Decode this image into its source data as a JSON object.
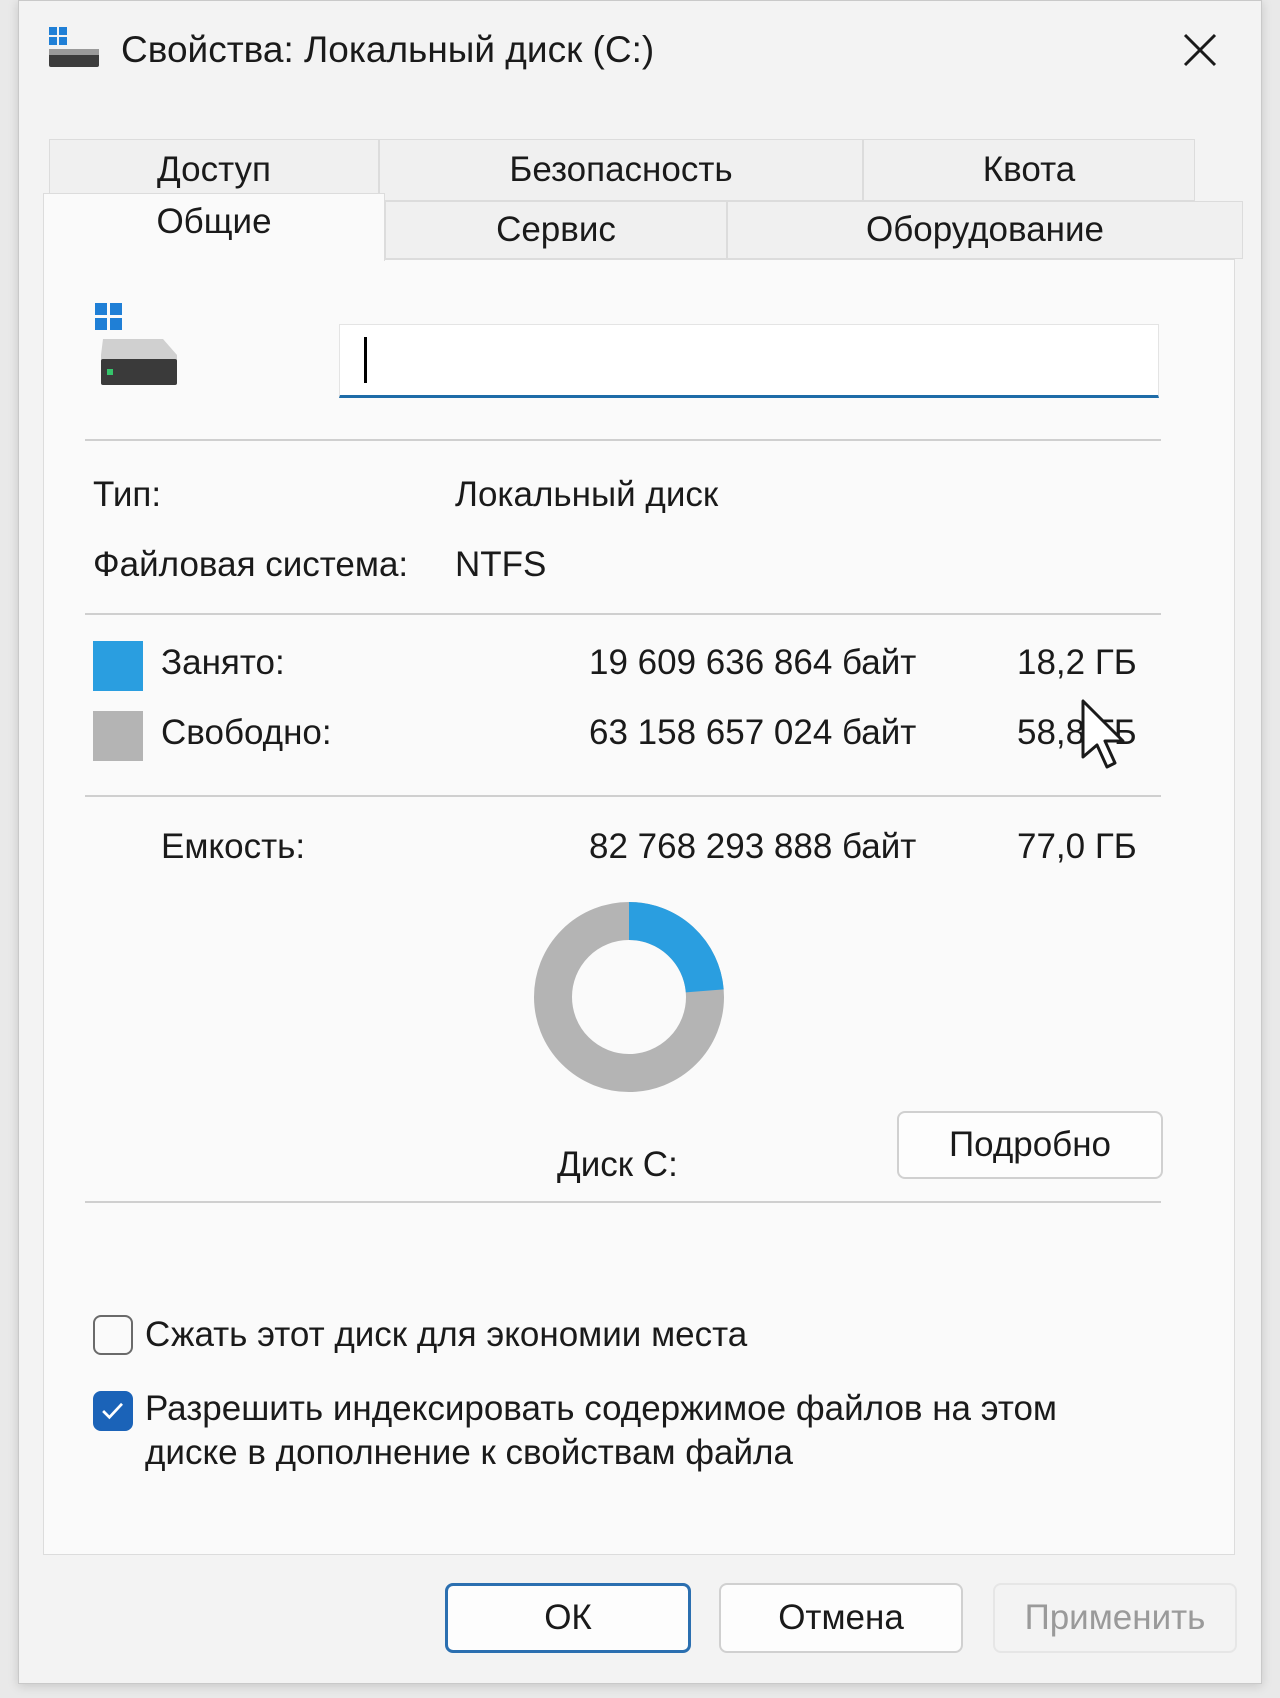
{
  "window": {
    "title": "Свойства: Локальный диск (C:)",
    "close_icon": "close-icon"
  },
  "tabs": {
    "row_top": [
      "Доступ",
      "Безопасность",
      "Квота"
    ],
    "row_bottom": [
      "Общие",
      "Сервис",
      "Оборудование"
    ],
    "active": "Общие"
  },
  "general": {
    "drive_icon": "drive-icon",
    "name_value": "",
    "type_label": "Тип:",
    "type_value": "Локальный диск",
    "fs_label": "Файловая система:",
    "fs_value": "NTFS",
    "used_label": "Занято:",
    "used_bytes": "19 609 636 864 байт",
    "used_size": "18,2 ГБ",
    "free_label": "Свободно:",
    "free_bytes": "63 158 657 024 байт",
    "free_size": "58,8 ГБ",
    "capacity_label": "Емкость:",
    "capacity_bytes": "82 768 293 888 байт",
    "capacity_size": "77,0 ГБ",
    "disk_label": "Диск C:",
    "details_button": "Подробно",
    "used_fraction": 0.237,
    "colors": {
      "used": "#2a9ee0",
      "free": "#b4b4b4"
    }
  },
  "options": {
    "compress_label": "Сжать этот диск для экономии места",
    "compress_checked": false,
    "index_label_line1": "Разрешить индексировать содержимое файлов на этом",
    "index_label_line2": "диске в дополнение к свойствам файла",
    "index_checked": true
  },
  "buttons": {
    "ok": "ОК",
    "cancel": "Отмена",
    "apply": "Применить"
  }
}
